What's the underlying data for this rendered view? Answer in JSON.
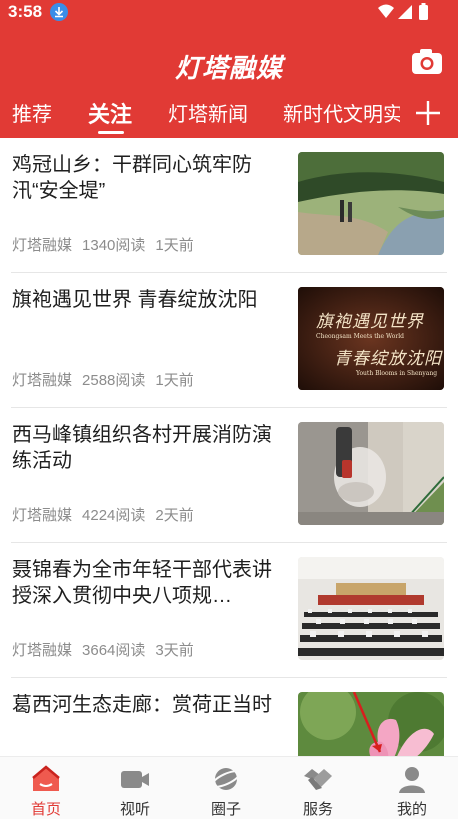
{
  "status_bar": {
    "time": "3:58"
  },
  "app": {
    "title": "灯塔融媒"
  },
  "tabs": [
    {
      "label": "推荐",
      "active": false
    },
    {
      "label": "关注",
      "active": true
    },
    {
      "label": "灯塔新闻",
      "active": false
    },
    {
      "label": "新时代文明实",
      "active": false
    }
  ],
  "articles": [
    {
      "title": "鸡冠山乡：干群同心筑牢防汛“安全堤”",
      "source": "灯塔融媒",
      "views": "1340阅读",
      "time": "1天前"
    },
    {
      "title": "旗袍遇见世界 青春绽放沈阳",
      "source": "灯塔融媒",
      "views": "2588阅读",
      "time": "1天前"
    },
    {
      "title": "西马峰镇组织各村开展消防演练活动",
      "source": "灯塔融媒",
      "views": "4224阅读",
      "time": "2天前"
    },
    {
      "title": "聂锦春为全市年轻干部代表讲授深入贯彻中央八项规…",
      "source": "灯塔融媒",
      "views": "3664阅读",
      "time": "3天前"
    },
    {
      "title": "葛西河生态走廊：赏荷正当时",
      "source": "",
      "views": "",
      "time": ""
    }
  ],
  "thumb_overlay": {
    "line1": "旗袍遇见世界",
    "line2": "Cheongsam Meets the World",
    "line3": "青春绽放沈阳",
    "line4": "Youth Blooms in Shenyang"
  },
  "bottom_nav": [
    {
      "label": "首页",
      "icon": "home-icon",
      "active": true
    },
    {
      "label": "视听",
      "icon": "video-icon",
      "active": false
    },
    {
      "label": "圈子",
      "icon": "planet-icon",
      "active": false
    },
    {
      "label": "服务",
      "icon": "handshake-icon",
      "active": false
    },
    {
      "label": "我的",
      "icon": "user-icon",
      "active": false
    }
  ],
  "colors": {
    "brand_red": "#e13a35",
    "meta_gray": "#8c8c8c",
    "title_text": "#1e1e1e"
  }
}
